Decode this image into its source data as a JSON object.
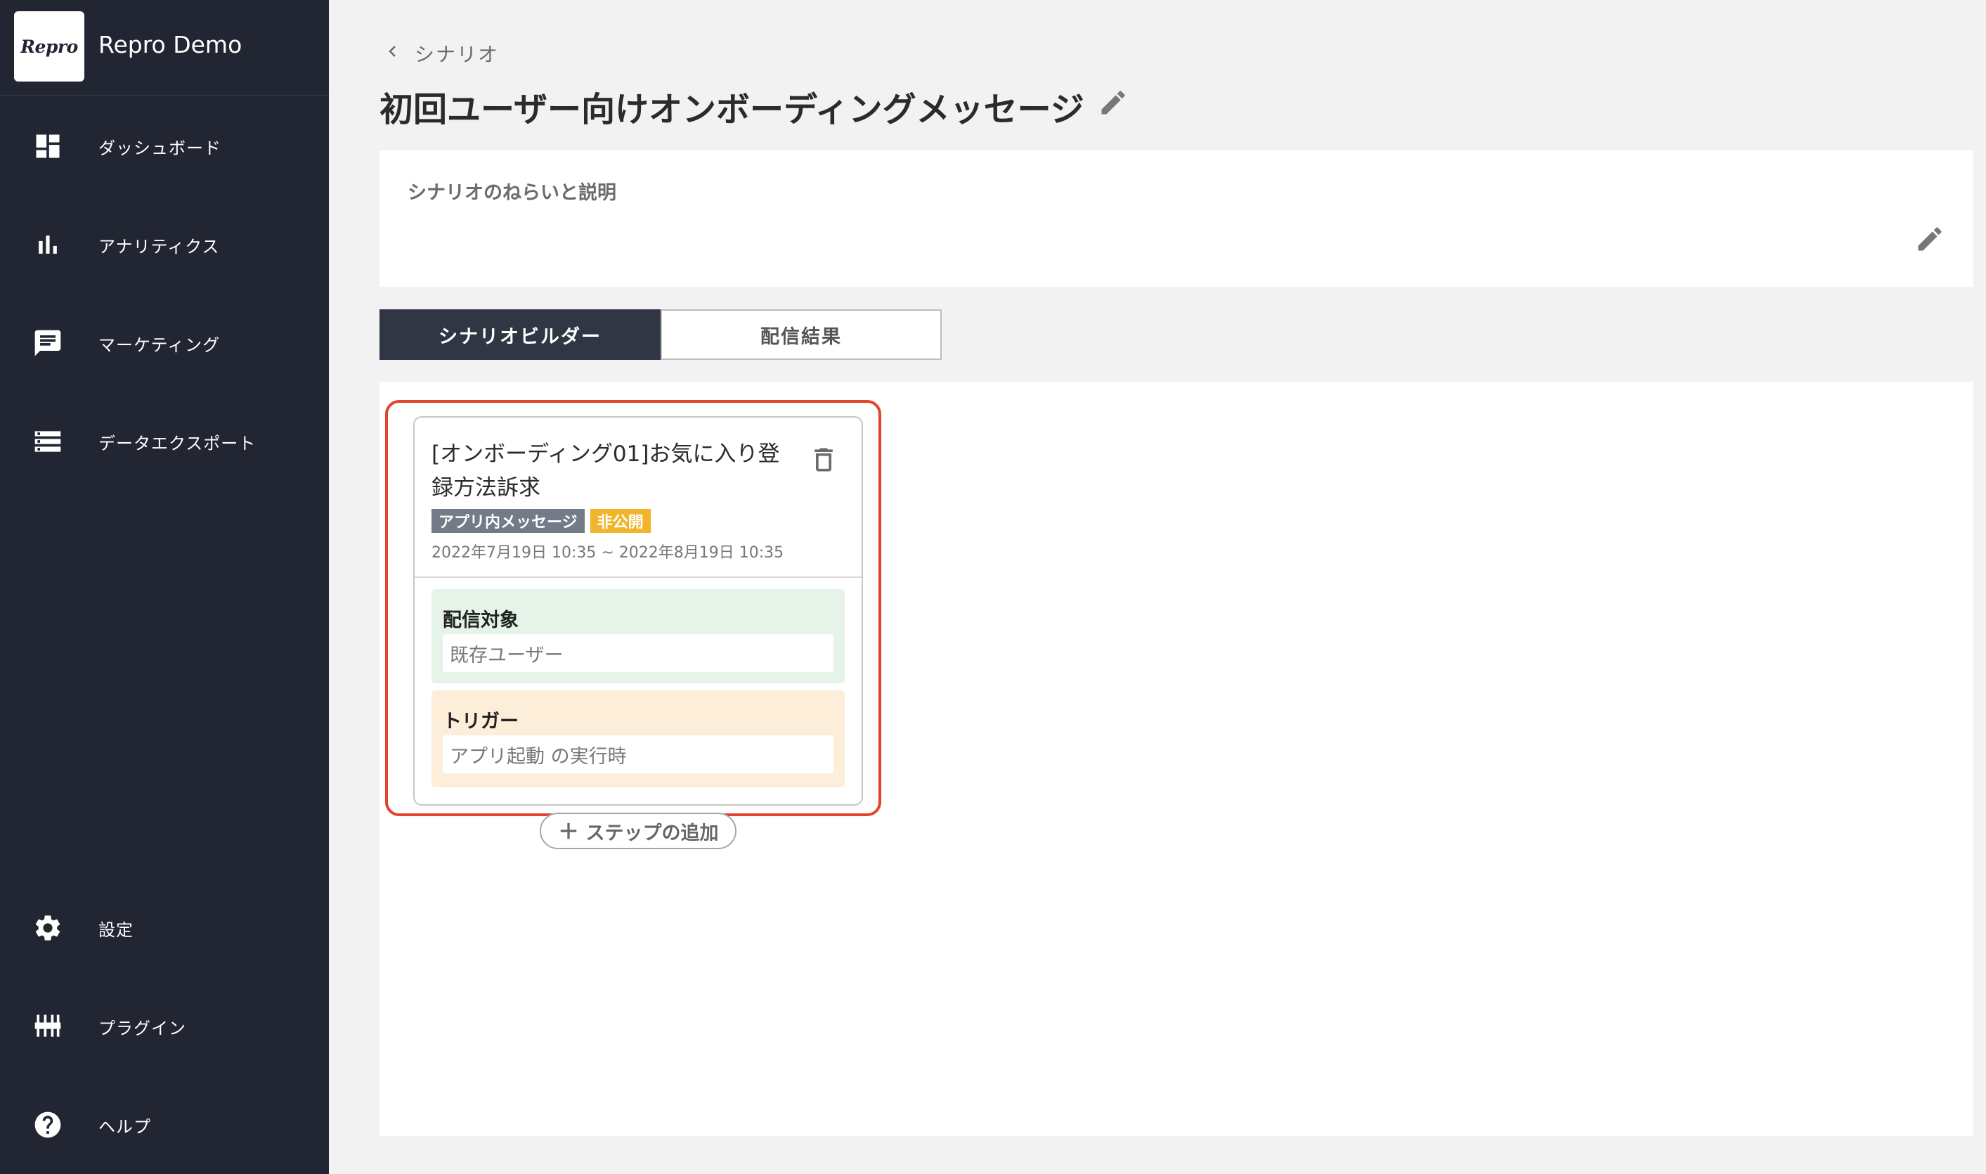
{
  "brand": {
    "logo_text": "Repro",
    "name": "Repro Demo"
  },
  "sidebar": {
    "items": [
      {
        "key": "dashboard",
        "label": "ダッシュボード",
        "icon": "dashboard-icon"
      },
      {
        "key": "analytics",
        "label": "アナリティクス",
        "icon": "bar-chart-icon"
      },
      {
        "key": "marketing",
        "label": "マーケティング",
        "icon": "message-icon"
      },
      {
        "key": "export",
        "label": "データエクスポート",
        "icon": "storage-icon"
      },
      {
        "key": "settings",
        "label": "設定",
        "icon": "gear-icon"
      },
      {
        "key": "plugin",
        "label": "プラグイン",
        "icon": "plugin-icon"
      },
      {
        "key": "help",
        "label": "ヘルプ",
        "icon": "help-icon"
      }
    ]
  },
  "header": {
    "breadcrumb": "シナリオ",
    "title": "初回ユーザー向けオンボーディングメッセージ"
  },
  "description": {
    "label": "シナリオのねらいと説明"
  },
  "tabs": [
    {
      "label": "シナリオビルダー",
      "active": true
    },
    {
      "label": "配信結果",
      "active": false
    }
  ],
  "step_card": {
    "title": "[オンボーディング01]お気に入り登録方法訴求",
    "badges": [
      {
        "label": "アプリ内メッセージ",
        "color": "#737a88"
      },
      {
        "label": "非公開",
        "color": "#f1b52b"
      }
    ],
    "date_range": "2022年7月19日 10:35 ~ 2022年8月19日 10:35",
    "target": {
      "label": "配信対象",
      "value": "既存ユーザー"
    },
    "trigger": {
      "label": "トリガー",
      "value": "アプリ起動 の実行時"
    }
  },
  "add_step_label": "ステップの追加",
  "colors": {
    "sidebar_bg": "#222633",
    "highlight": "#e2432c",
    "target_bg": "#e5f3e8",
    "trigger_bg": "#fdeeda"
  }
}
